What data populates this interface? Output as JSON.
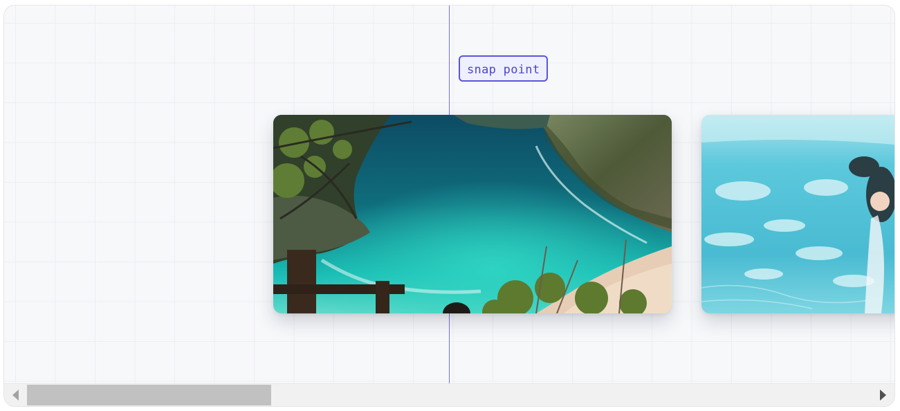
{
  "snap": {
    "label": "snap point",
    "accent_color": "#5b5bd6"
  },
  "carousel": {
    "items": [
      {
        "name": "cliff-beach-photo"
      },
      {
        "name": "underwater-fish-photo"
      }
    ]
  },
  "scrollbar": {
    "left_arrow": "left-arrow-icon",
    "right_arrow": "right-arrow-icon",
    "thumb_fraction": 0.28,
    "position_fraction": 0.0
  }
}
